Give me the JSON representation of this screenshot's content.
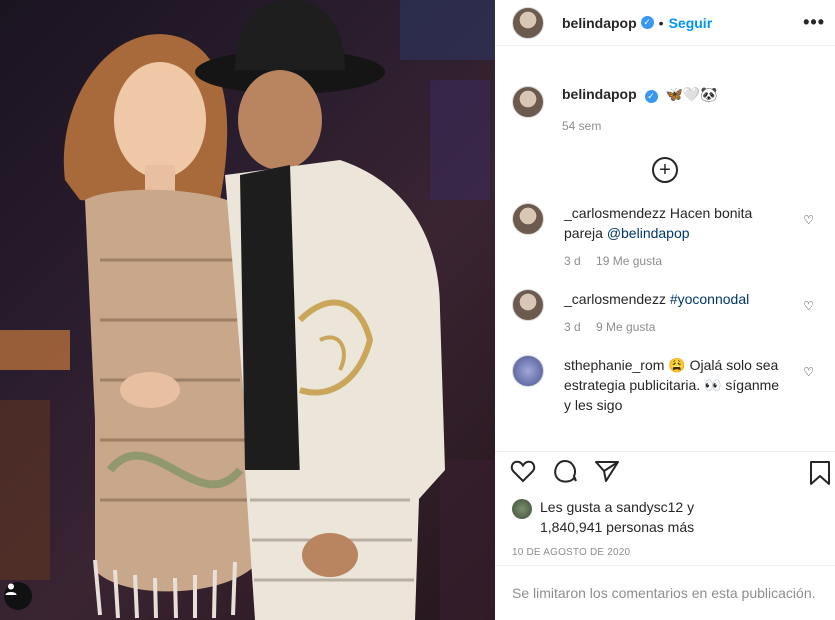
{
  "post": {
    "username": "belindapop",
    "follow_label": "Seguir",
    "dot": "•",
    "more": "•••",
    "caption": {
      "emojis": "🦋🤍🐼",
      "time": "54 sem"
    },
    "load_more_symbol": "+"
  },
  "comments": [
    {
      "user": "_carlosmendezz",
      "text": "Hacen bonita pareja",
      "mention": "@belindapop",
      "time": "3 d",
      "likes": "19 Me gusta"
    },
    {
      "user": "_carlosmendezz",
      "text": "",
      "mention": "#yoconnodal",
      "time": "3 d",
      "likes": "9 Me gusta"
    },
    {
      "user": "sthephanie_rom",
      "text": "😩 Ojalá solo sea estrategia publicitaria. 👀 síganme y les sigo",
      "mention": "",
      "time": "",
      "likes": ""
    }
  ],
  "likes": {
    "prefix": "Les gusta a",
    "user": "sandysc12",
    "connector": "y",
    "count": "1,840,941 personas más"
  },
  "date": "10 DE AGOSTO DE 2020",
  "comments_limited": "Se limitaron los comentarios en esta publicación."
}
